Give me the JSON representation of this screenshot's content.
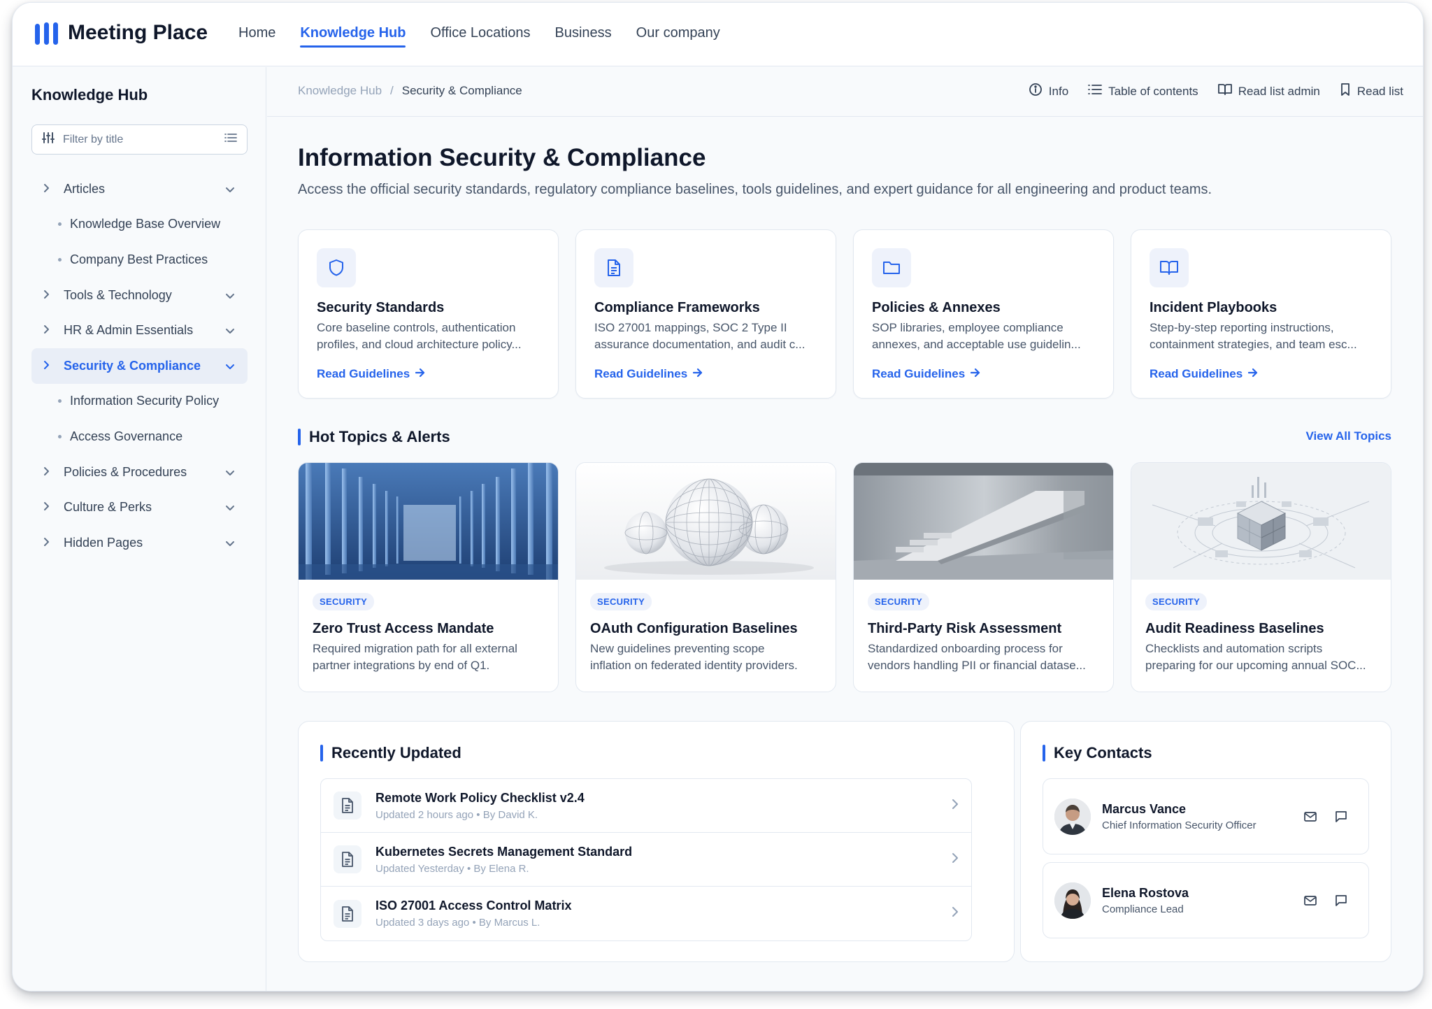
{
  "app": {
    "name": "Meeting Place"
  },
  "nav": {
    "items": [
      "Home",
      "Knowledge Hub",
      "Office Locations",
      "Business",
      "Our company"
    ],
    "active": "Knowledge Hub"
  },
  "sidebar": {
    "title": "Knowledge Hub",
    "filter_placeholder": "Filter by title",
    "items": [
      {
        "type": "group",
        "label": "Articles",
        "active": false
      },
      {
        "type": "sub",
        "label": "Knowledge Base Overview"
      },
      {
        "type": "sub",
        "label": "Company Best Practices"
      },
      {
        "type": "group",
        "label": "Tools & Technology",
        "active": false
      },
      {
        "type": "group",
        "label": "HR & Admin Essentials",
        "active": false
      },
      {
        "type": "group",
        "label": "Security & Compliance",
        "active": true
      },
      {
        "type": "sub",
        "label": "Information Security Policy"
      },
      {
        "type": "sub",
        "label": "Access Governance"
      },
      {
        "type": "group",
        "label": "Policies & Procedures",
        "active": false
      },
      {
        "type": "group",
        "label": "Culture & Perks",
        "active": false
      },
      {
        "type": "group",
        "label": "Hidden Pages",
        "active": false
      }
    ]
  },
  "breadcrumb": {
    "root": "Knowledge Hub",
    "separator": "/",
    "current": "Security & Compliance"
  },
  "actions": {
    "info": "Info",
    "toc": "Table of contents",
    "admin": "Read list admin",
    "readlist": "Read list"
  },
  "page": {
    "title": "Information Security & Compliance",
    "subtitle": "Access the official security standards, regulatory compliance baselines, tools guidelines, and expert guidance for all engineering and product teams."
  },
  "cards": [
    {
      "icon": "shield-icon",
      "title": "Security Standards",
      "desc1": "Core baseline controls, authentication",
      "desc2": "profiles, and cloud architecture policy...",
      "link": "Read Guidelines"
    },
    {
      "icon": "document-icon",
      "title": "Compliance Frameworks",
      "desc1": "ISO 27001 mappings, SOC 2 Type II",
      "desc2": "assurance documentation, and audit c...",
      "link": "Read Guidelines"
    },
    {
      "icon": "folder-icon",
      "title": "Policies & Annexes",
      "desc1": "SOP libraries, employee compliance",
      "desc2": "annexes, and acceptable use guidelin...",
      "link": "Read Guidelines"
    },
    {
      "icon": "book-icon",
      "title": "Incident Playbooks",
      "desc1": "Step-by-step reporting instructions,",
      "desc2": "containment strategies, and team esc...",
      "link": "Read Guidelines"
    }
  ],
  "hot_topics": {
    "title": "Hot Topics & Alerts",
    "view_all": "View All Topics",
    "items": [
      {
        "badge": "SECURITY",
        "title": "Zero Trust Access Mandate",
        "desc1": "Required migration path for all external",
        "desc2": "partner integrations by end of Q1."
      },
      {
        "badge": "SECURITY",
        "title": "OAuth Configuration Baselines",
        "desc1": "New guidelines preventing scope",
        "desc2": "inflation on federated identity providers."
      },
      {
        "badge": "SECURITY",
        "title": "Third-Party Risk Assessment",
        "desc1": "Standardized onboarding process for",
        "desc2": "vendors handling PII or financial datase..."
      },
      {
        "badge": "SECURITY",
        "title": "Audit Readiness Baselines",
        "desc1": "Checklists and automation scripts",
        "desc2": "preparing for our upcoming annual SOC..."
      }
    ]
  },
  "recent": {
    "title": "Recently Updated",
    "items": [
      {
        "title": "Remote Work Policy Checklist v2.4",
        "updated": "Updated 2 hours ago",
        "sep": "•",
        "author": "By David K."
      },
      {
        "title": "Kubernetes Secrets Management Standard",
        "updated": "Updated Yesterday",
        "sep": "•",
        "author": "By Elena R."
      },
      {
        "title": "ISO 27001 Access Control Matrix",
        "updated": "Updated 3 days ago",
        "sep": "•",
        "author": "By Marcus L."
      }
    ]
  },
  "contacts": {
    "title": "Key Contacts",
    "items": [
      {
        "name": "Marcus Vance",
        "role": "Chief Information Security Officer"
      },
      {
        "name": "Elena Rostova",
        "role": "Compliance Lead"
      }
    ]
  },
  "colors": {
    "accent": "#2563eb",
    "text": "#0f172a",
    "muted": "#475569",
    "border": "#e2e8f0",
    "background": "#f8fafc"
  }
}
